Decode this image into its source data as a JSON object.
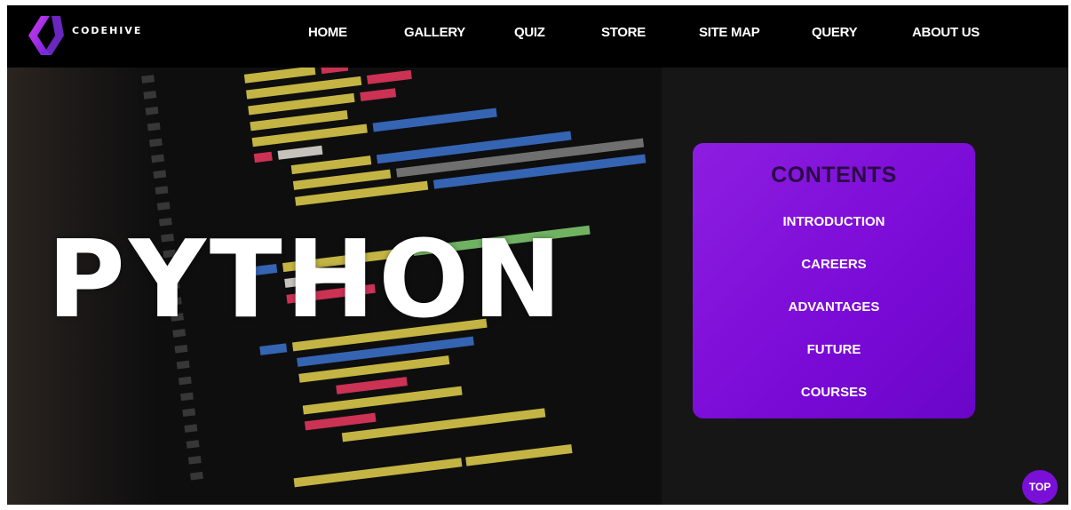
{
  "brand": {
    "name": "CODEHIVE"
  },
  "nav": {
    "items": [
      {
        "label": "HOME"
      },
      {
        "label": "GALLERY"
      },
      {
        "label": "QUIZ"
      },
      {
        "label": "STORE"
      },
      {
        "label": "SITE MAP"
      },
      {
        "label": "QUERY"
      },
      {
        "label": "ABOUT US"
      }
    ]
  },
  "hero": {
    "title": "PYTHON"
  },
  "contents": {
    "title": "CONTENTS",
    "items": [
      {
        "label": "INTRODUCTION"
      },
      {
        "label": "CAREERS"
      },
      {
        "label": "ADVANTAGES"
      },
      {
        "label": "FUTURE"
      },
      {
        "label": "COURSES"
      }
    ]
  },
  "top_button": {
    "label": "TOP"
  },
  "colors": {
    "accent": "#7a0ad6",
    "nav_bg": "#000000",
    "page_bg": "#161616",
    "card_title": "#2a0a44"
  }
}
